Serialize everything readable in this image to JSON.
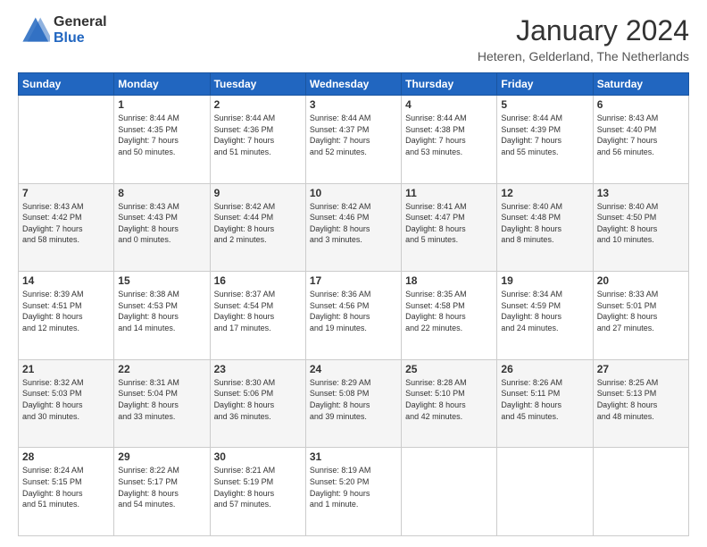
{
  "logo": {
    "line1": "General",
    "line2": "Blue"
  },
  "title": "January 2024",
  "location": "Heteren, Gelderland, The Netherlands",
  "days_header": [
    "Sunday",
    "Monday",
    "Tuesday",
    "Wednesday",
    "Thursday",
    "Friday",
    "Saturday"
  ],
  "weeks": [
    [
      {
        "num": "",
        "info": ""
      },
      {
        "num": "1",
        "info": "Sunrise: 8:44 AM\nSunset: 4:35 PM\nDaylight: 7 hours\nand 50 minutes."
      },
      {
        "num": "2",
        "info": "Sunrise: 8:44 AM\nSunset: 4:36 PM\nDaylight: 7 hours\nand 51 minutes."
      },
      {
        "num": "3",
        "info": "Sunrise: 8:44 AM\nSunset: 4:37 PM\nDaylight: 7 hours\nand 52 minutes."
      },
      {
        "num": "4",
        "info": "Sunrise: 8:44 AM\nSunset: 4:38 PM\nDaylight: 7 hours\nand 53 minutes."
      },
      {
        "num": "5",
        "info": "Sunrise: 8:44 AM\nSunset: 4:39 PM\nDaylight: 7 hours\nand 55 minutes."
      },
      {
        "num": "6",
        "info": "Sunrise: 8:43 AM\nSunset: 4:40 PM\nDaylight: 7 hours\nand 56 minutes."
      }
    ],
    [
      {
        "num": "7",
        "info": "Sunrise: 8:43 AM\nSunset: 4:42 PM\nDaylight: 7 hours\nand 58 minutes."
      },
      {
        "num": "8",
        "info": "Sunrise: 8:43 AM\nSunset: 4:43 PM\nDaylight: 8 hours\nand 0 minutes."
      },
      {
        "num": "9",
        "info": "Sunrise: 8:42 AM\nSunset: 4:44 PM\nDaylight: 8 hours\nand 2 minutes."
      },
      {
        "num": "10",
        "info": "Sunrise: 8:42 AM\nSunset: 4:46 PM\nDaylight: 8 hours\nand 3 minutes."
      },
      {
        "num": "11",
        "info": "Sunrise: 8:41 AM\nSunset: 4:47 PM\nDaylight: 8 hours\nand 5 minutes."
      },
      {
        "num": "12",
        "info": "Sunrise: 8:40 AM\nSunset: 4:48 PM\nDaylight: 8 hours\nand 8 minutes."
      },
      {
        "num": "13",
        "info": "Sunrise: 8:40 AM\nSunset: 4:50 PM\nDaylight: 8 hours\nand 10 minutes."
      }
    ],
    [
      {
        "num": "14",
        "info": "Sunrise: 8:39 AM\nSunset: 4:51 PM\nDaylight: 8 hours\nand 12 minutes."
      },
      {
        "num": "15",
        "info": "Sunrise: 8:38 AM\nSunset: 4:53 PM\nDaylight: 8 hours\nand 14 minutes."
      },
      {
        "num": "16",
        "info": "Sunrise: 8:37 AM\nSunset: 4:54 PM\nDaylight: 8 hours\nand 17 minutes."
      },
      {
        "num": "17",
        "info": "Sunrise: 8:36 AM\nSunset: 4:56 PM\nDaylight: 8 hours\nand 19 minutes."
      },
      {
        "num": "18",
        "info": "Sunrise: 8:35 AM\nSunset: 4:58 PM\nDaylight: 8 hours\nand 22 minutes."
      },
      {
        "num": "19",
        "info": "Sunrise: 8:34 AM\nSunset: 4:59 PM\nDaylight: 8 hours\nand 24 minutes."
      },
      {
        "num": "20",
        "info": "Sunrise: 8:33 AM\nSunset: 5:01 PM\nDaylight: 8 hours\nand 27 minutes."
      }
    ],
    [
      {
        "num": "21",
        "info": "Sunrise: 8:32 AM\nSunset: 5:03 PM\nDaylight: 8 hours\nand 30 minutes."
      },
      {
        "num": "22",
        "info": "Sunrise: 8:31 AM\nSunset: 5:04 PM\nDaylight: 8 hours\nand 33 minutes."
      },
      {
        "num": "23",
        "info": "Sunrise: 8:30 AM\nSunset: 5:06 PM\nDaylight: 8 hours\nand 36 minutes."
      },
      {
        "num": "24",
        "info": "Sunrise: 8:29 AM\nSunset: 5:08 PM\nDaylight: 8 hours\nand 39 minutes."
      },
      {
        "num": "25",
        "info": "Sunrise: 8:28 AM\nSunset: 5:10 PM\nDaylight: 8 hours\nand 42 minutes."
      },
      {
        "num": "26",
        "info": "Sunrise: 8:26 AM\nSunset: 5:11 PM\nDaylight: 8 hours\nand 45 minutes."
      },
      {
        "num": "27",
        "info": "Sunrise: 8:25 AM\nSunset: 5:13 PM\nDaylight: 8 hours\nand 48 minutes."
      }
    ],
    [
      {
        "num": "28",
        "info": "Sunrise: 8:24 AM\nSunset: 5:15 PM\nDaylight: 8 hours\nand 51 minutes."
      },
      {
        "num": "29",
        "info": "Sunrise: 8:22 AM\nSunset: 5:17 PM\nDaylight: 8 hours\nand 54 minutes."
      },
      {
        "num": "30",
        "info": "Sunrise: 8:21 AM\nSunset: 5:19 PM\nDaylight: 8 hours\nand 57 minutes."
      },
      {
        "num": "31",
        "info": "Sunrise: 8:19 AM\nSunset: 5:20 PM\nDaylight: 9 hours\nand 1 minute."
      },
      {
        "num": "",
        "info": ""
      },
      {
        "num": "",
        "info": ""
      },
      {
        "num": "",
        "info": ""
      }
    ]
  ]
}
